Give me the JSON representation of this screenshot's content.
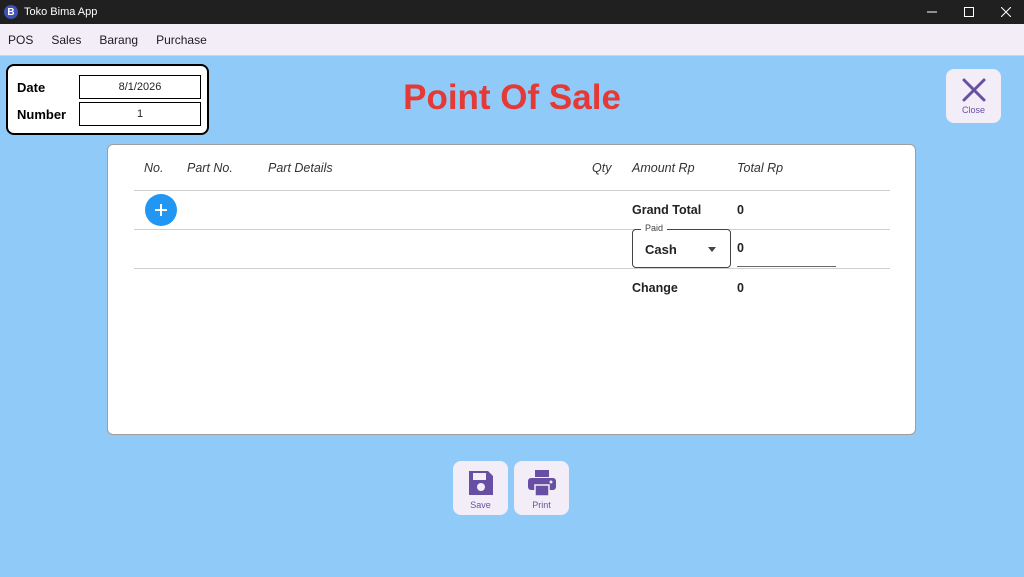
{
  "window": {
    "logo_letter": "B",
    "title": "Toko Bima App"
  },
  "menu": [
    {
      "label": "POS"
    },
    {
      "label": "Sales"
    },
    {
      "label": "Barang"
    },
    {
      "label": "Purchase"
    }
  ],
  "info": {
    "date_label": "Date",
    "date_value": "8/1/2026",
    "number_label": "Number",
    "number_value": "1"
  },
  "page_title": "Point Of Sale",
  "close_button": {
    "label": "Close",
    "icon": "close-icon"
  },
  "table": {
    "columns": [
      "No.",
      "Part No.",
      "Part Details",
      "Qty",
      "Amount Rp",
      "Total Rp"
    ],
    "add_icon": "plus-icon"
  },
  "summary": {
    "grand_total_label": "Grand Total",
    "grand_total_value": "0",
    "paid_label": "Paid",
    "paid_method": "Cash",
    "paid_value": "0",
    "change_label": "Change",
    "change_value": "0"
  },
  "actions": {
    "save_label": "Save",
    "print_label": "Print"
  },
  "colors": {
    "background": "#90caf9",
    "title_red": "#e53935",
    "accent_purple": "#6750a4",
    "add_blue": "#2196f3"
  }
}
